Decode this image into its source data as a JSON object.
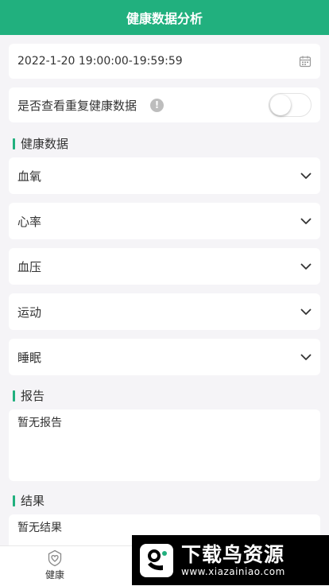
{
  "header": {
    "title": "健康数据分析"
  },
  "datetime": {
    "value": "2022-1-20 19:00:00-19:59:59"
  },
  "toggle": {
    "label": "是否查看重复健康数据",
    "info_glyph": "!",
    "state": "off"
  },
  "sections": {
    "health": {
      "title": "健康数据"
    },
    "report": {
      "title": "报告",
      "content": "暂无报告"
    },
    "result": {
      "title": "结果",
      "content": "暂无结果"
    }
  },
  "accordions": [
    {
      "label": "血氧"
    },
    {
      "label": "心率"
    },
    {
      "label": "血压"
    },
    {
      "label": "运动"
    },
    {
      "label": "睡眠"
    }
  ],
  "bottom_nav": {
    "health_label": "健康"
  },
  "watermark": {
    "title": "下载鸟资源",
    "url": "www.xiazainiao.com"
  },
  "colors": {
    "accent": "#21b07e",
    "background": "#f5f4f7"
  },
  "icons": {
    "calendar": "calendar-icon",
    "info": "info-icon",
    "chevron": "chevron-down-icon",
    "nav_health": "heart-shield-icon"
  }
}
